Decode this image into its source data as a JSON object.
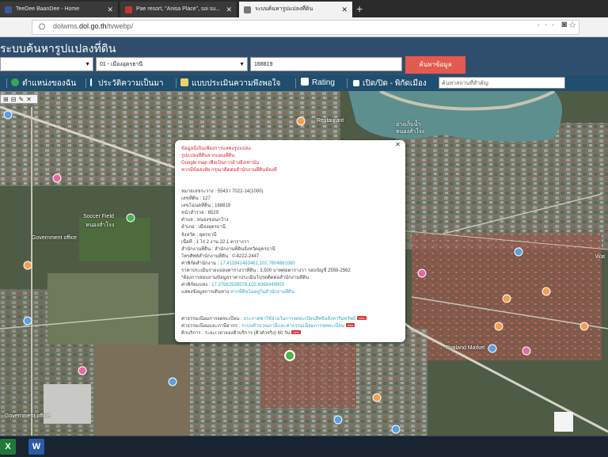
{
  "browser": {
    "tabs": [
      {
        "title": "TeeDee BaanDee - Home",
        "favicon_color": "#3b5998"
      },
      {
        "title": "Pae resort, \"Anisa Place\", soi su...",
        "favicon_color": "#c0392b"
      },
      {
        "title": "ระบบค้นหารูปแปลงที่ดิน",
        "favicon_color": "#777777"
      }
    ],
    "new_tab": "+",
    "url_prefix": "dolwms.",
    "url_domain": "dol.go.th",
    "url_path": "/tvwebp/"
  },
  "app": {
    "title": "ระบบค้นหารูปแปลงที่ดิน",
    "province_select": "",
    "district_select": "01 - เมืองอุดรธานี",
    "parcel_input": "168819",
    "search_button": "ค้นหาข้อมูล",
    "accent_color": "#e55a4e",
    "header_color": "#2f4e6e"
  },
  "toolbar": {
    "item1": "ตำแหน่งของฉัน",
    "item2": "ประวัติความเป็นมา",
    "item3": "แบบประเมินความพึงพอใจ",
    "item4": "Rating",
    "item5": "เปิด/ปิด - พิกัดเมือง",
    "place_placeholder": "ค้นหาสถานที่สำคัญ"
  },
  "map": {
    "labels": {
      "soccer": "Soccer Field",
      "soccer2": "หนองสำโรง",
      "govt": "Government office",
      "market": "Thailand Market",
      "govt2": "Government office",
      "wat": "Wat",
      "lake": "อ่างเก็บน้ำ",
      "lake2": "หนองสำโรง",
      "restaurant": "Restaurant"
    }
  },
  "popup": {
    "warning": [
      "ข้อมูลนี้เป็นเพียงการแสดงรูปแปลง",
      "รูปแปลงที่ดินจากแผนที่ดิน",
      "Google map เพื่อเป็นการอ้างอิงเท่านั้น",
      "หากมีข้อสงสัย กรุณาติดต่อสำนักงานที่ดินท้องที่"
    ],
    "rows": [
      {
        "label": "หมายเลขระวาง :",
        "value": "5543 I 7022-14(1000)"
      },
      {
        "label": "เลขที่ดิน :",
        "value": "127"
      },
      {
        "label": "เลขโฉนดที่ดิน :",
        "value": "168819"
      },
      {
        "label": "หน้าสำรวจ :",
        "value": "6529"
      },
      {
        "label": "ตำบล :",
        "value": "หนองขอนกว้าง"
      },
      {
        "label": "อำเภอ :",
        "value": "เมืองอุดรธานี"
      },
      {
        "label": "จังหวัด :",
        "value": "อุดรธานี"
      },
      {
        "label": "เนื้อที่ :",
        "value": "1 ไร่ 2 งาน 22.1 ตารางวา"
      },
      {
        "label": "สำนักงานที่ดิน :",
        "value": "สำนักงานที่ดินจังหวัดอุดรธานี"
      },
      {
        "label": "โทรศัพท์สำนักงานที่ดิน :",
        "value": "0-4222-2447"
      }
    ],
    "office_coord_label": "ค่าพิกัดสำนักงาน :",
    "office_coord_value": "17.411841493461,102.7604661080",
    "price_label": "ราคาประเมินรายแปลงตารางวาที่ดิน :",
    "price_value": "3,500 บาทต่อตารางวา รอบบัญชี 2559-2562",
    "notice": "*ต้องการสอบถามข้อมูลราคาประเมินโปรดติดต่อสำนักงานที่ดิน",
    "parcel_coord_label": "ค่าพิกัดแปลง :",
    "parcel_coord_value": "17.37682939578,102.8368449903",
    "queue_label": "แสดงข้อมูลการเดินทาง",
    "queue_value": "หากที่ดินไม่อยู่ในสำนักงานที่ดิน",
    "link1_label": "ค่าธรรมเนียมการจดทะเบียน :",
    "link1_value": "ประกาศค่าใช้จ่ายในการจดทะเบียนสิทธิอสังหาริมทรัพย์",
    "link2_label": "ค่าธรรมเนียมและภาษีอากร :",
    "link2_value": "ระบบคำนวณภาษีและค่าธรรมเนียมการจดทะเบียน",
    "link3_label": "คิวบริการ :",
    "link3_value": "ระยะเวลาจองคิวบริการ (คิวตัวจริง) 60 วัน",
    "badge": "new"
  }
}
